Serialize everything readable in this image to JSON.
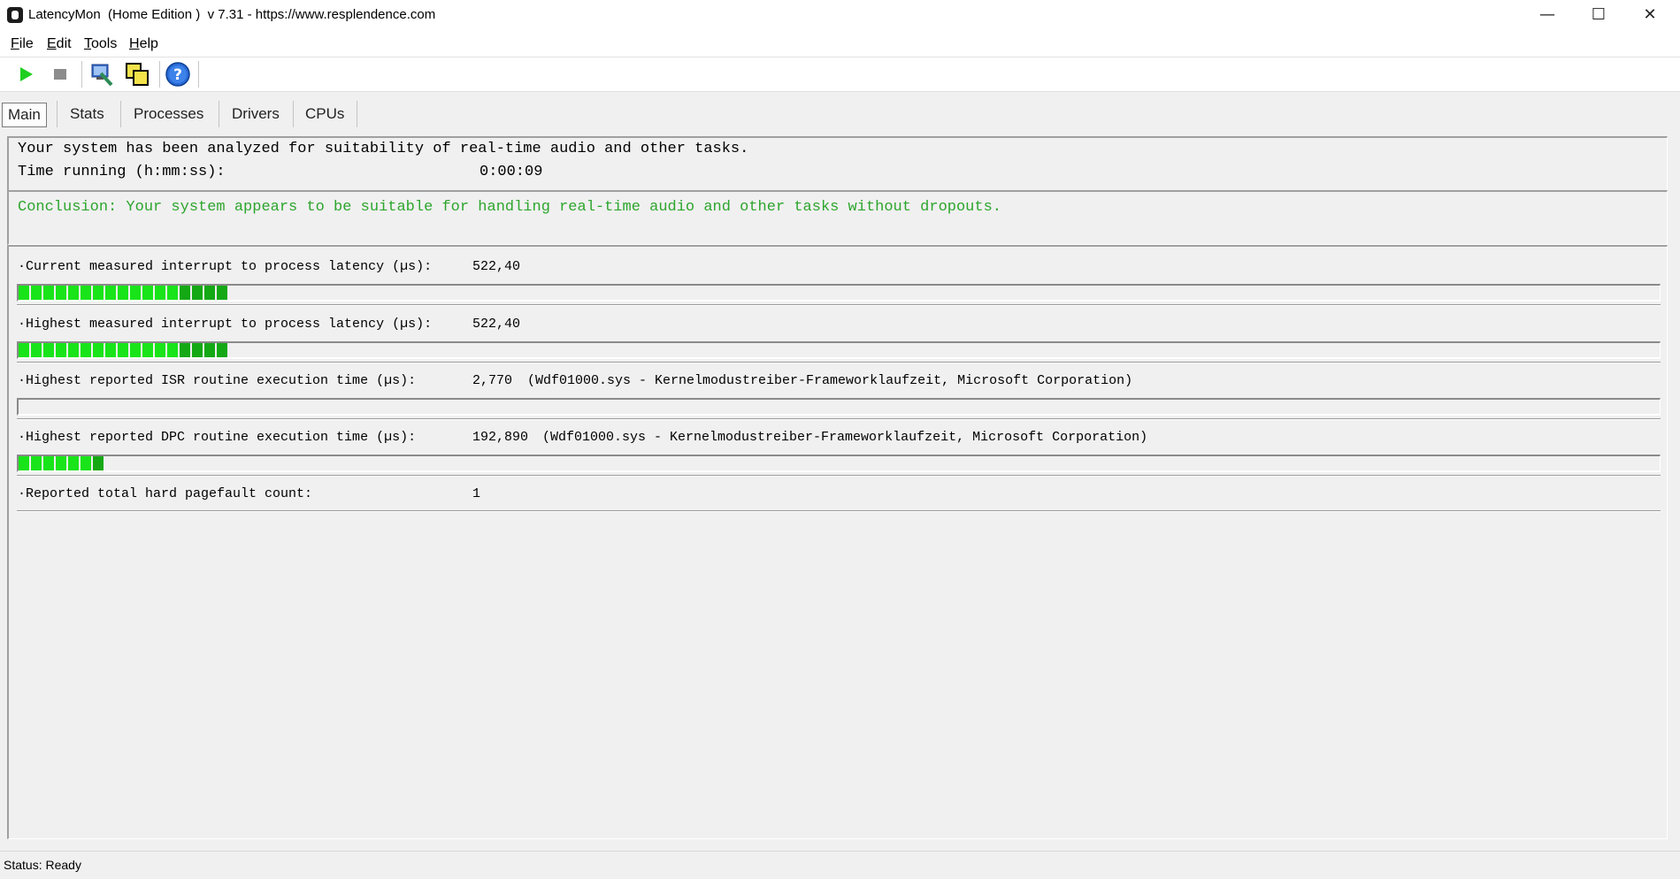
{
  "window": {
    "title": "LatencyMon  (Home Edition )  v 7.31 - https://www.resplendence.com",
    "minimize": "—",
    "maximize": "☐",
    "close": "✕"
  },
  "menu": [
    {
      "label": "File",
      "hotkey": "F",
      "rest": "ile"
    },
    {
      "label": "Edit",
      "hotkey": "E",
      "rest": "dit"
    },
    {
      "label": "Tools",
      "hotkey": "T",
      "rest": "ools"
    },
    {
      "label": "Help",
      "hotkey": "H",
      "rest": "elp"
    }
  ],
  "toolbar": {
    "icons": [
      "play-icon",
      "stop-icon",
      "analyze-icon",
      "copy-icon",
      "help-icon"
    ]
  },
  "tabs": [
    {
      "label": "Main",
      "active": true
    },
    {
      "label": "Stats",
      "active": false
    },
    {
      "label": "Processes",
      "active": false
    },
    {
      "label": "Drivers",
      "active": false
    },
    {
      "label": "CPUs",
      "active": false
    }
  ],
  "summary": {
    "analysis_text": "Your system has been analyzed for suitability of real-time audio and other tasks.",
    "time_label": "Time running (h:mm:ss):",
    "time_value": "0:00:09"
  },
  "conclusion": {
    "text": "Conclusion: Your system appears to be suitable for handling real-time audio and other tasks without dropouts.",
    "color": "#2da52d"
  },
  "stats": [
    {
      "label": "·Current measured interrupt to process latency (µs):",
      "value": "522,40",
      "detail": "",
      "bar_segments": 17,
      "bar_dark_start": 13
    },
    {
      "label": "·Highest measured interrupt to process latency (µs):",
      "value": "522,40",
      "detail": "",
      "bar_segments": 17,
      "bar_dark_start": 13
    },
    {
      "label": "·Highest reported ISR routine execution time (µs):",
      "value": "2,770",
      "detail": "(Wdf01000.sys - Kernelmodustreiber-Frameworklaufzeit, Microsoft Corporation)",
      "bar_segments": 0,
      "bar_dark_start": 0
    },
    {
      "label": "·Highest reported DPC routine execution time (µs):",
      "value": "192,890",
      "detail": "(Wdf01000.sys - Kernelmodustreiber-Frameworklaufzeit, Microsoft Corporation)",
      "bar_segments": 7,
      "bar_dark_start": 6
    },
    {
      "label": "·Reported total hard pagefault count:",
      "value": "1",
      "detail": ""
    }
  ],
  "status": {
    "text": "Status: Ready"
  }
}
